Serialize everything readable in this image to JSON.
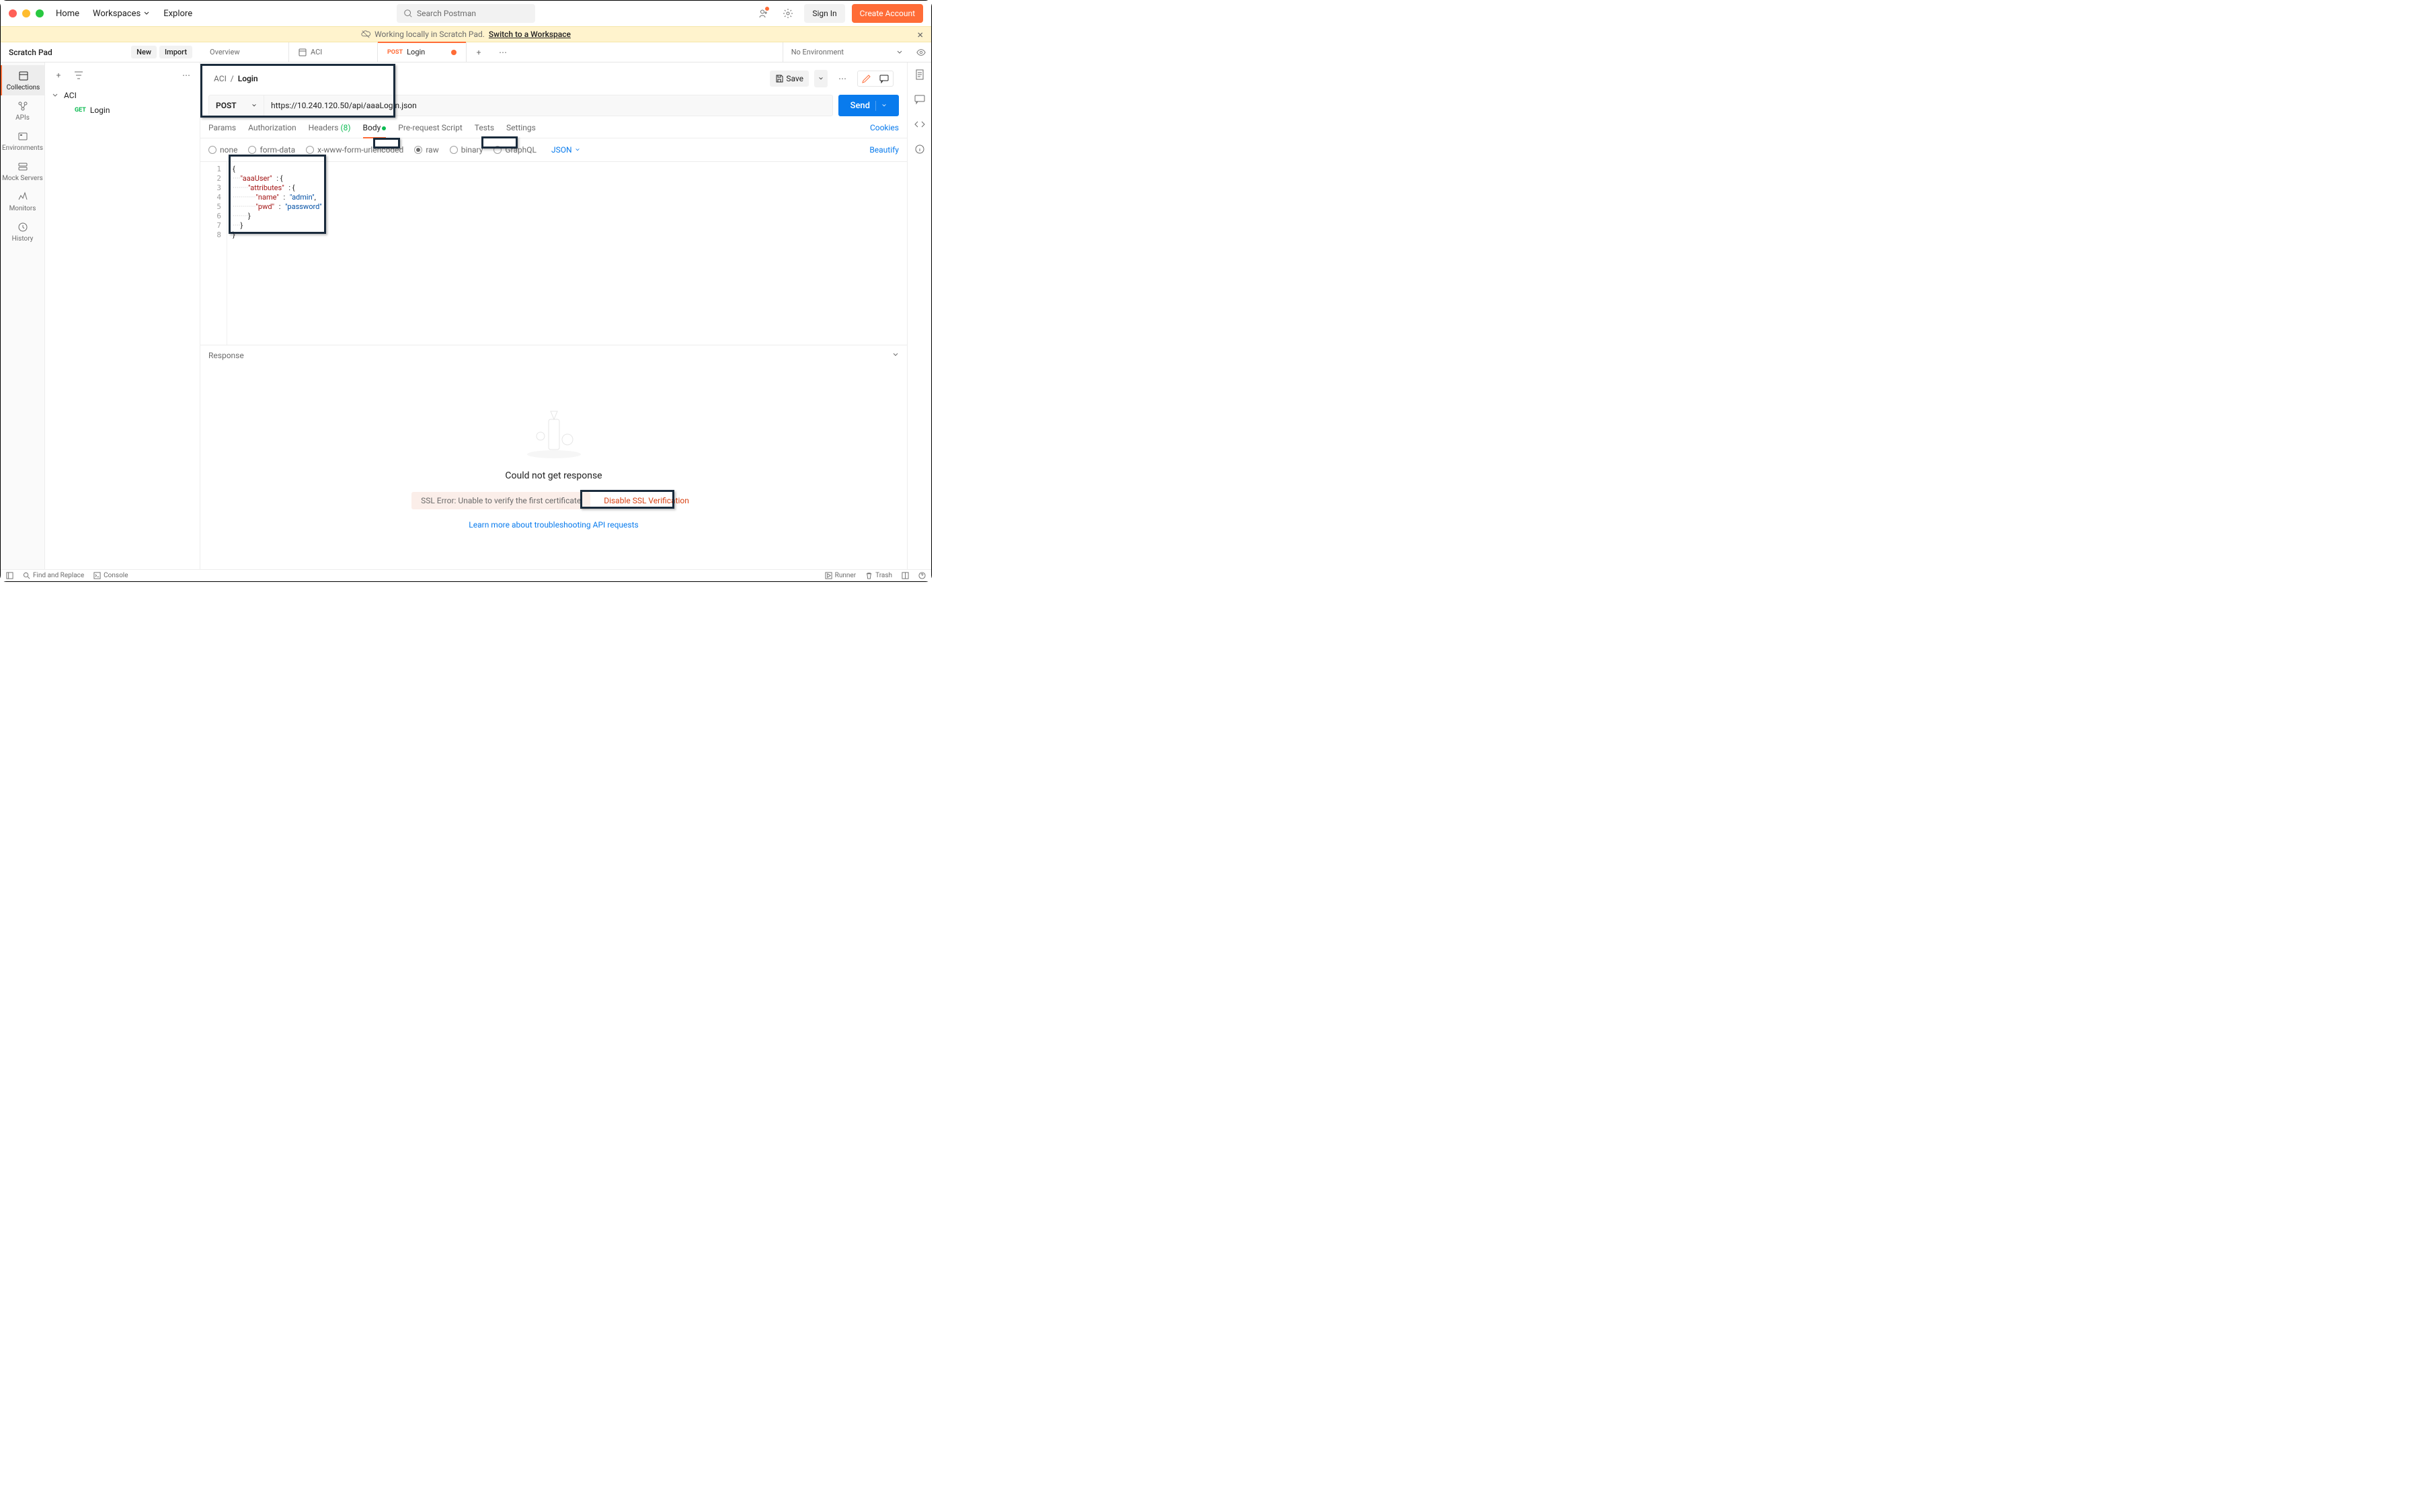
{
  "toolbar": {
    "nav": [
      "Home",
      "Workspaces",
      "Explore"
    ],
    "search_placeholder": "Search Postman",
    "signin": "Sign In",
    "create": "Create Account"
  },
  "banner": {
    "text": "Working locally in Scratch Pad.",
    "link": "Switch to a Workspace"
  },
  "workspace": {
    "title": "Scratch Pad",
    "new_btn": "New",
    "import_btn": "Import",
    "env": "No Environment"
  },
  "tabs": [
    {
      "label": "Overview",
      "kind": "plain"
    },
    {
      "label": "ACI",
      "kind": "collection"
    },
    {
      "label": "Login",
      "kind": "request",
      "method": "POST",
      "active": true,
      "dirty": true
    }
  ],
  "side_icons": [
    {
      "label": "Collections",
      "active": true
    },
    {
      "label": "APIs"
    },
    {
      "label": "Environments"
    },
    {
      "label": "Mock Servers"
    },
    {
      "label": "Monitors"
    },
    {
      "label": "History"
    }
  ],
  "tree": {
    "collection": "ACI",
    "items": [
      {
        "method": "GET",
        "name": "Login"
      }
    ]
  },
  "request": {
    "breadcrumb_parent": "ACI",
    "breadcrumb_name": "Login",
    "save": "Save",
    "method": "POST",
    "url": "https://10.240.120.50/api/aaaLogin.json",
    "send": "Send",
    "tabs": [
      "Params",
      "Authorization",
      "Headers",
      "Body",
      "Pre-request Script",
      "Tests",
      "Settings"
    ],
    "headers_count": "(8)",
    "active_tab": "Body",
    "cookies": "Cookies",
    "body_types": [
      "none",
      "form-data",
      "x-www-form-urlencoded",
      "raw",
      "binary",
      "GraphQL"
    ],
    "body_selected": "raw",
    "body_lang": "JSON",
    "beautify": "Beautify",
    "editor_lines": [
      "{",
      "    \"aaaUser\" : {",
      "        \"attributes\" : {",
      "            \"name\" : \"admin\",",
      "            \"pwd\" : \"password\"",
      "        }",
      "    }",
      "}"
    ]
  },
  "response": {
    "label": "Response",
    "title": "Could not get response",
    "ssl_error": "SSL Error: Unable to verify the first certificate",
    "disable_ssl": "Disable SSL Verification",
    "learn": "Learn more about troubleshooting API requests"
  },
  "statusbar": {
    "find": "Find and Replace",
    "console": "Console",
    "runner": "Runner",
    "trash": "Trash"
  }
}
